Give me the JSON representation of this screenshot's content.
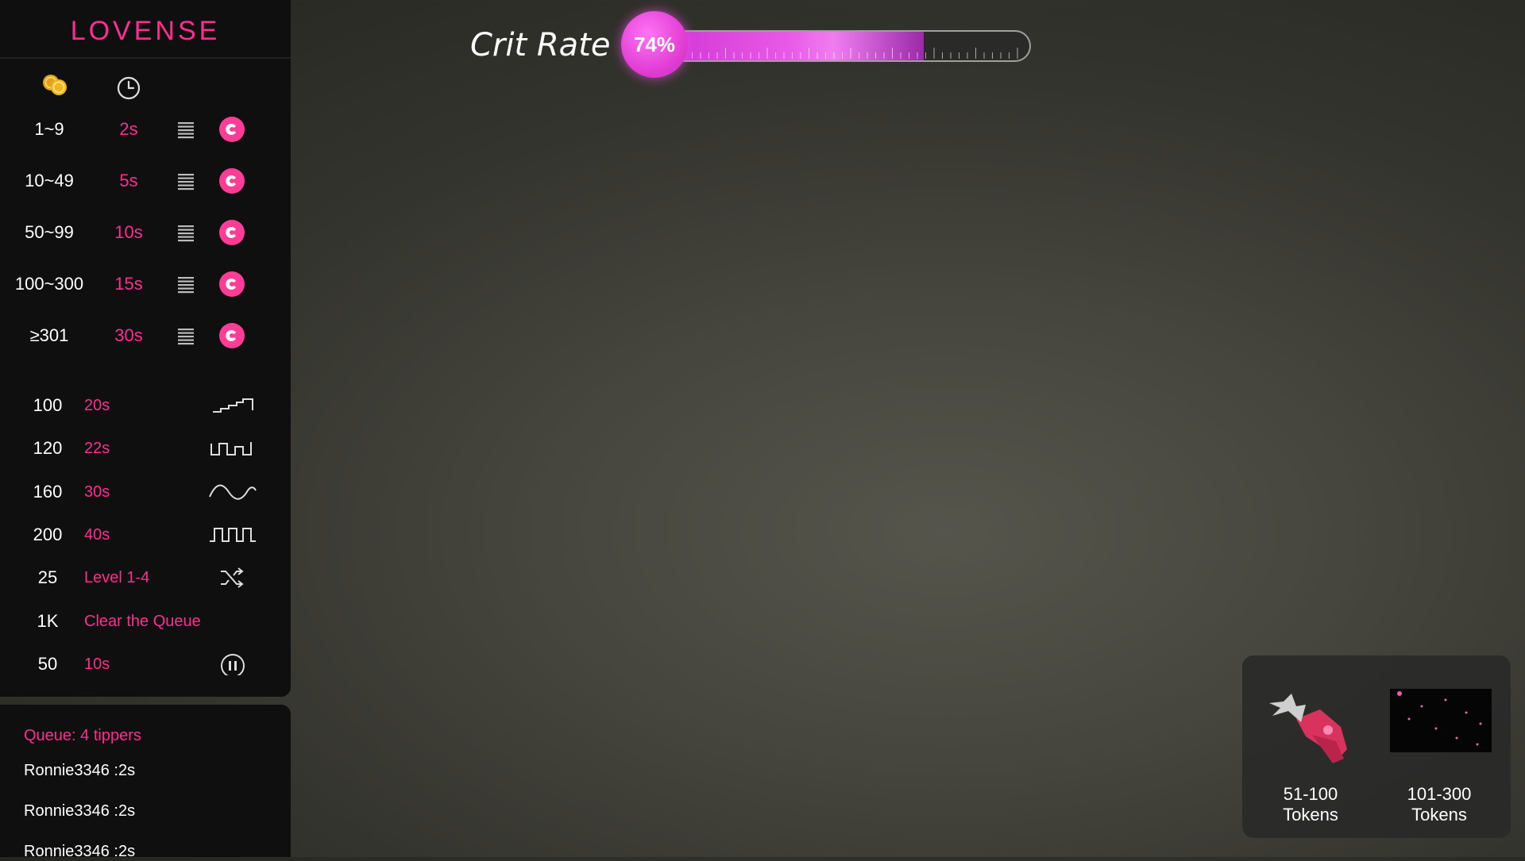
{
  "brand": "LOVENSE",
  "crit": {
    "label": "Crit Rate",
    "percent_text": "74%",
    "progress": 0.74
  },
  "levels": [
    {
      "range": "1~9",
      "duration": "2s"
    },
    {
      "range": "10~49",
      "duration": "5s"
    },
    {
      "range": "50~99",
      "duration": "10s"
    },
    {
      "range": "100~300",
      "duration": "15s"
    },
    {
      "range": "≥301",
      "duration": "30s"
    }
  ],
  "patterns": [
    {
      "amount": "100",
      "label": "20s",
      "icon": "wave-steps-up-icon"
    },
    {
      "amount": "120",
      "label": "22s",
      "icon": "wave-pulse-icon"
    },
    {
      "amount": "160",
      "label": "30s",
      "icon": "wave-sine-icon"
    },
    {
      "amount": "200",
      "label": "40s",
      "icon": "wave-square-icon"
    },
    {
      "amount": "25",
      "label": "Level 1-4",
      "icon": "shuffle-icon"
    },
    {
      "amount": "1K",
      "label": "Clear the Queue",
      "icon": ""
    },
    {
      "amount": "50",
      "label": "10s",
      "icon": "pause-icon"
    }
  ],
  "queue": {
    "title": "Queue: 4 tippers",
    "items": [
      "Ronnie3346 :2s",
      "Ronnie3346 :2s",
      "Ronnie3346 :2s"
    ]
  },
  "rewards": [
    {
      "label_line1": "51-100",
      "label_line2": "Tokens"
    },
    {
      "label_line1": "101-300",
      "label_line2": "Tokens"
    }
  ],
  "colors": {
    "accent": "#ff2d8f",
    "panel": "#0f0f0f",
    "crit_fill": "#e85ae6"
  }
}
